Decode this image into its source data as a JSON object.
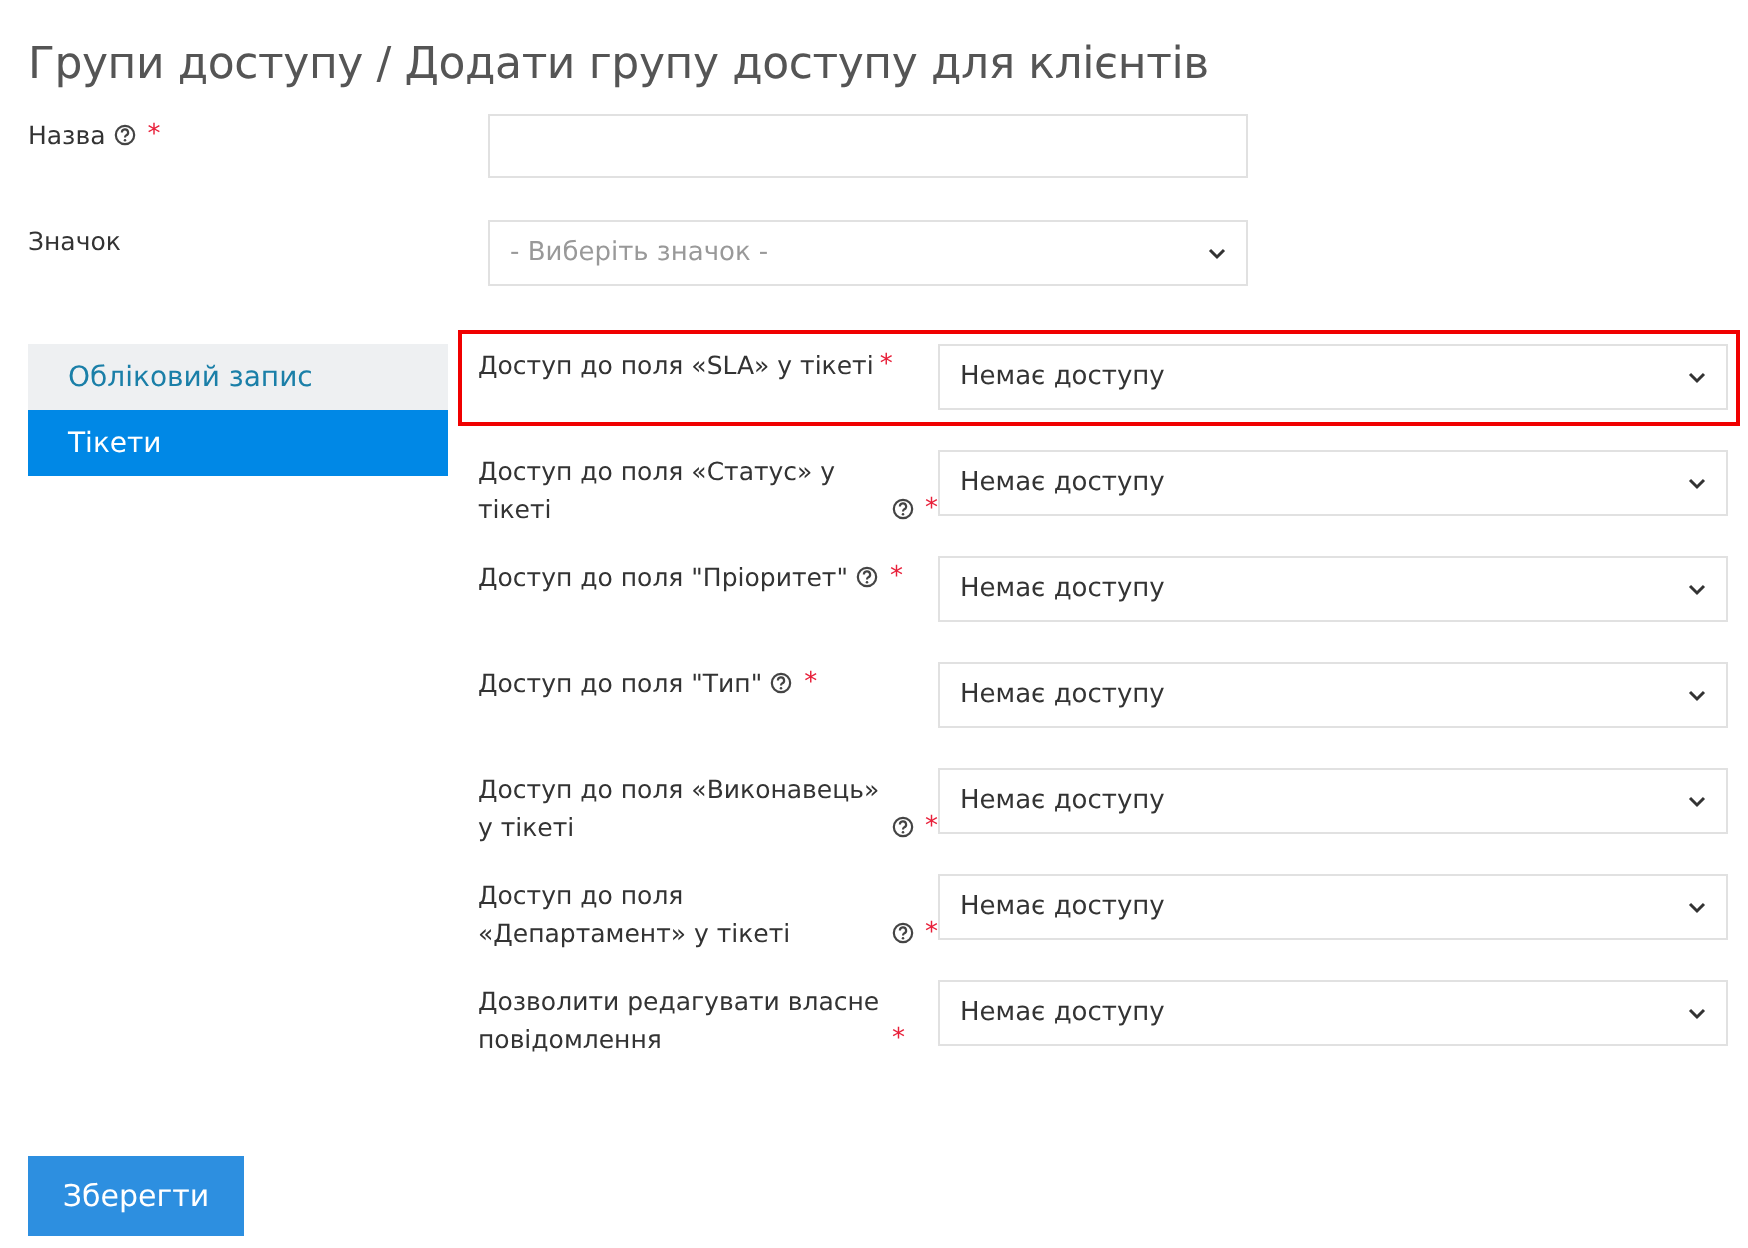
{
  "title": "Групи доступу / Додати групу доступу для клієнтів",
  "top_fields": [
    {
      "kind": "text",
      "label": "Назва",
      "help": true,
      "required": true
    },
    {
      "kind": "select",
      "label": "Значок",
      "help": false,
      "required": false,
      "placeholder": "- Виберіть значок -"
    }
  ],
  "sidebar": {
    "items": [
      {
        "label": "Обліковий запис",
        "selected": false
      },
      {
        "label": "Тікети",
        "selected": true
      }
    ]
  },
  "access_fields": [
    {
      "label": "Доступ до поля «SLA» у тікеті",
      "help": false,
      "required": true,
      "highlighted": true,
      "value": "Немає доступу"
    },
    {
      "label": "Доступ до поля «Статус» у тікеті",
      "help": true,
      "required": true,
      "highlighted": false,
      "value": "Немає доступу"
    },
    {
      "label": "Доступ до поля \"Пріоритет\"",
      "help": true,
      "required": true,
      "highlighted": false,
      "value": "Немає доступу"
    },
    {
      "label": "Доступ до поля \"Тип\"",
      "help": true,
      "required": true,
      "highlighted": false,
      "value": "Немає доступу"
    },
    {
      "label": "Доступ до поля «Виконавець» у тікеті",
      "help": true,
      "required": true,
      "highlighted": false,
      "value": "Немає доступу"
    },
    {
      "label": "Доступ до поля «Департамент» у тікеті",
      "help": true,
      "required": true,
      "highlighted": false,
      "value": "Немає доступу"
    },
    {
      "label": "Дозволити редагувати власне повідомлення",
      "help": false,
      "required": true,
      "highlighted": false,
      "value": "Немає доступу"
    }
  ],
  "save_button": "Зберегти",
  "required_mark": "*"
}
